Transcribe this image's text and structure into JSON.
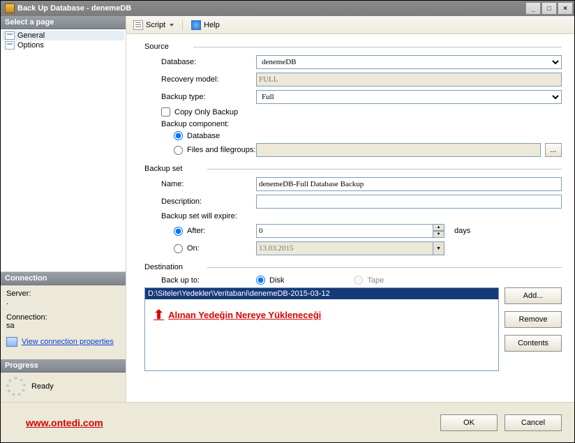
{
  "window": {
    "title": "Back Up Database - denemeDB",
    "min_label": "_",
    "max_label": "□",
    "close_label": "×"
  },
  "sidebar": {
    "select_page_header": "Select a page",
    "pages": [
      {
        "label": "General",
        "selected": true
      },
      {
        "label": "Options",
        "selected": false
      }
    ],
    "connection": {
      "header": "Connection",
      "server_label": "Server:",
      "server_value": ".",
      "connection_label": "Connection:",
      "connection_value": "sa",
      "view_conn_props": "View connection properties"
    },
    "progress": {
      "header": "Progress",
      "status": "Ready"
    }
  },
  "toolbar": {
    "script_label": "Script",
    "help_label": "Help"
  },
  "form": {
    "source": {
      "legend": "Source",
      "database_label": "Database:",
      "database_value": "denemeDB",
      "recovery_model_label": "Recovery model:",
      "recovery_model_value": "FULL",
      "backup_type_label": "Backup type:",
      "backup_type_value": "Full",
      "copy_only_label": "Copy Only Backup",
      "backup_component_label": "Backup component:",
      "radio_database": "Database",
      "radio_filegroups": "Files and filegroups:",
      "filegroups_value": "",
      "browse_label": "..."
    },
    "backup_set": {
      "legend": "Backup set",
      "name_label": "Name:",
      "name_value": "denemeDB-Full Database Backup",
      "description_label": "Description:",
      "description_value": "",
      "expire_label": "Backup set will expire:",
      "radio_after": "After:",
      "after_value": "0",
      "after_unit": "days",
      "radio_on": "On:",
      "on_value": "13.03.2015"
    },
    "destination": {
      "legend": "Destination",
      "backup_to_label": "Back up to:",
      "radio_disk": "Disk",
      "radio_tape": "Tape",
      "paths": [
        "D:\\Siteler\\Yedekler\\Veritabani\\denemeDB-2015-03-12"
      ],
      "annotation_text": "Alınan Yedeğin Nereye Yükleneceği",
      "btn_add": "Add...",
      "btn_remove": "Remove",
      "btn_contents": "Contents"
    }
  },
  "footer": {
    "website": "www.ontedi.com",
    "ok_label": "OK",
    "cancel_label": "Cancel"
  }
}
